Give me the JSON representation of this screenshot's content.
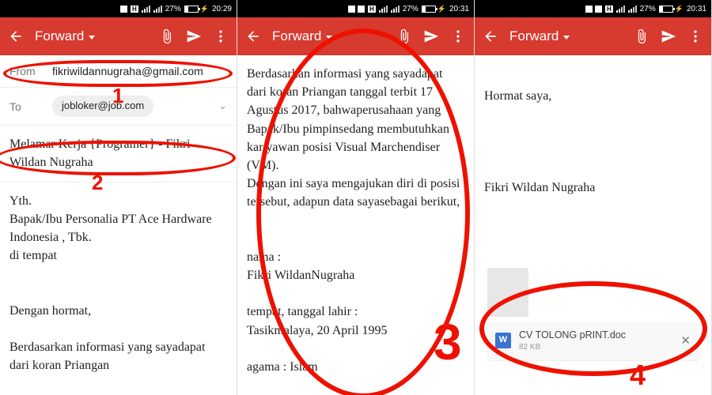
{
  "statusbar": {
    "icons": [
      "H"
    ],
    "battery_pct": "27%",
    "net": "",
    "times": [
      "20:29",
      "20:31",
      "20:31"
    ]
  },
  "appbar": {
    "title": "Forward"
  },
  "panel1": {
    "from_label": "From",
    "from_value": "fikriwildannugraha@gmail.com",
    "to_label": "To",
    "to_value": "jobloker@job.com",
    "subject": "Melamar Kerja {Programer} - Fikri Wildan Nugraha",
    "body": "Yth.\nBapak/Ibu Personalia PT Ace Hardware Indonesia , Tbk.\ndi tempat\n\n\nDengan hormat,\n\nBerdasarkan informasi yang sayadapat dari koran Priangan"
  },
  "panel2": {
    "body": "Berdasarkan informasi yang sayadapat dari koran Priangan tanggal terbit 17 Agustus 2017, bahwaperusahaan yang Bapak/Ibu pimpinsedang membutuhkan kar yawan posisi Visual Marchendiser (VM).\nDengan ini saya mengajukan diri di posisi tersebut, adapun data sayasebagai berikut,\n\n\nnama                               :\nFikri WildanNugraha\n\ntempat, tanggal lahir        :\nTasikmalaya, 20  April 1995\n\nagama                              : Islam"
  },
  "panel3": {
    "body_top": "Hormat saya,\n\n\n\n\nFikri Wildan Nugraha",
    "attachment_name": "CV TOLONG pRINT.doc",
    "attachment_size": "82 KB",
    "doc_letter": "W"
  },
  "annotations": {
    "n1": "1",
    "n2": "2",
    "n3": "3",
    "n4": "4"
  }
}
